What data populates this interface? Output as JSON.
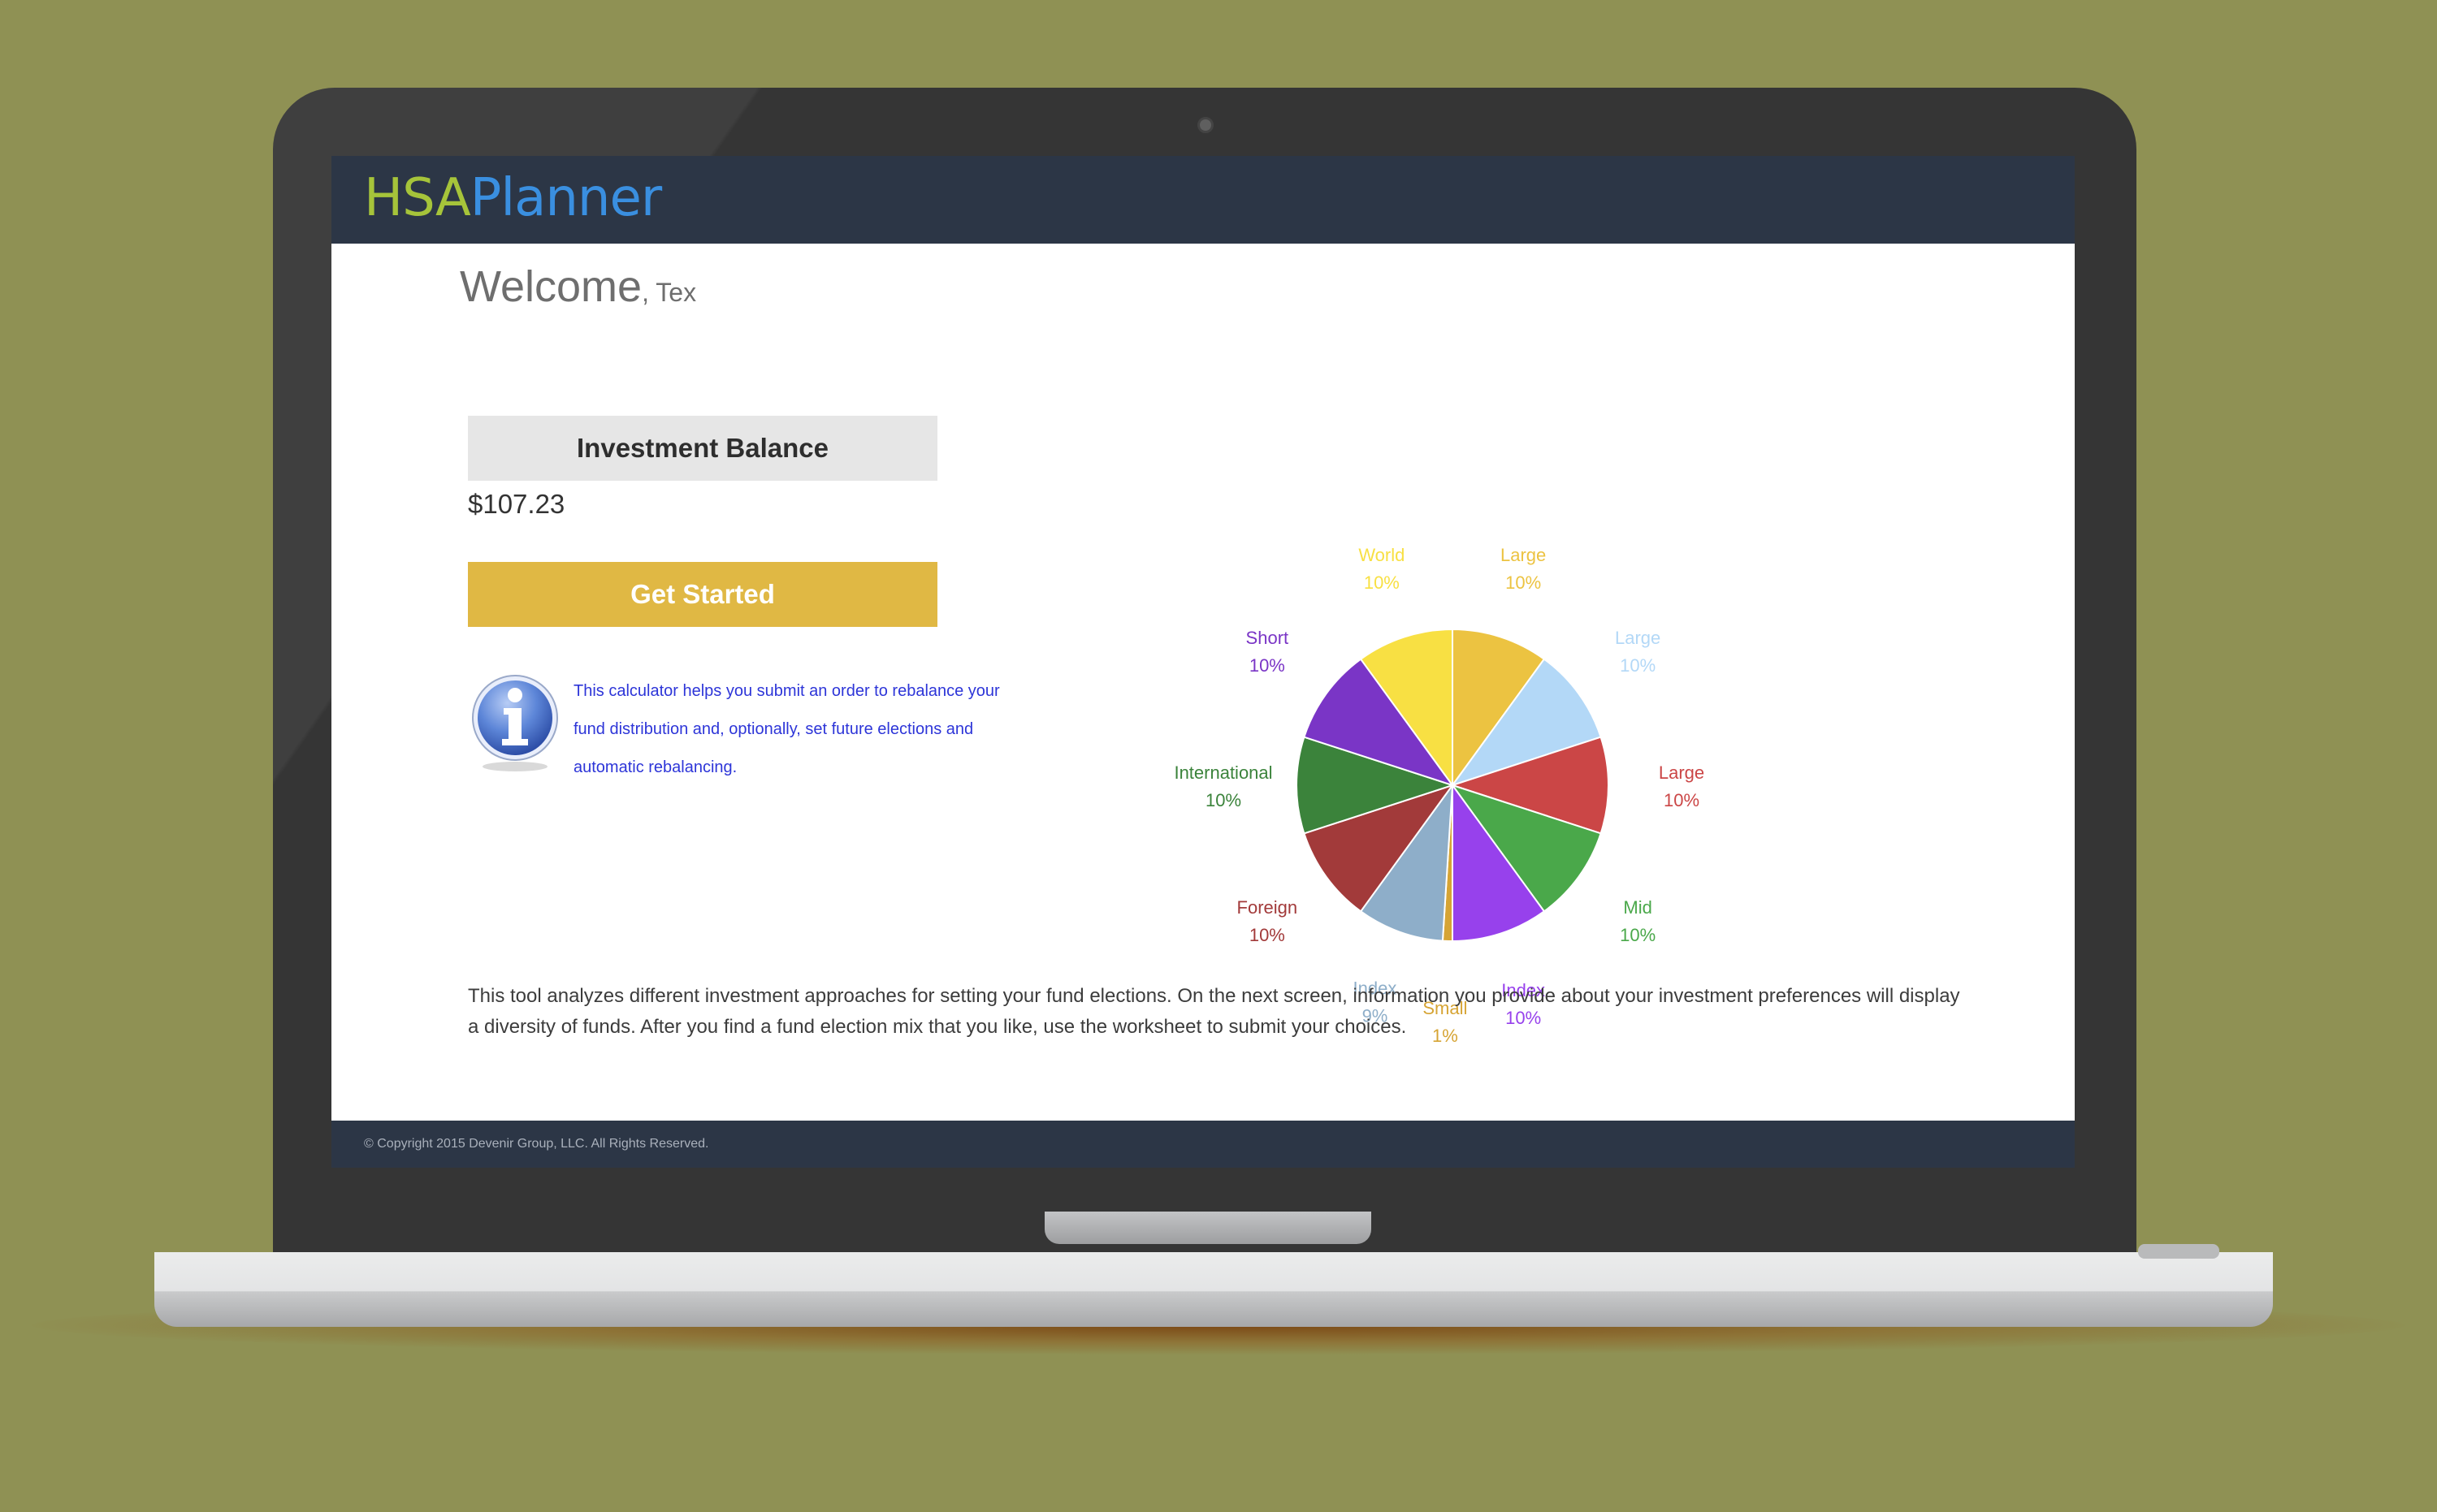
{
  "app": {
    "logo_part1": "HSA",
    "logo_part2": "Planner"
  },
  "welcome": {
    "greeting": "Welcome",
    "name": ", Tex"
  },
  "balance": {
    "label": "Investment Balance",
    "value": "$107.23"
  },
  "actions": {
    "get_started_label": "Get Started"
  },
  "info": {
    "icon": "info-icon",
    "text": "This calculator helps you submit an order to rebalance your fund distribution and, optionally, set future elections and automatic rebalancing."
  },
  "description": "This tool analyzes different investment approaches for setting your fund elections. On the next screen, information you provide about your investment preferences will display a diversity of funds. After you find a fund election mix that you like, use the worksheet to submit your choices.",
  "footer": {
    "copyright": "© Copyright 2015 Devenir Group, LLC. All Rights Reserved."
  },
  "colors": {
    "header_bg": "#2c3646",
    "logo_hsa": "#a6c43a",
    "logo_planner": "#3a8fe0",
    "button_bg": "#e0b844",
    "info_text": "#2d35d8"
  },
  "chart_data": {
    "type": "pie",
    "title": "",
    "legend": "none",
    "slices": [
      {
        "label": "Large",
        "value": 10,
        "display": "10%",
        "color": "#ecc341"
      },
      {
        "label": "Large",
        "value": 10,
        "display": "10%",
        "color": "#b3d8f7"
      },
      {
        "label": "Large",
        "value": 10,
        "display": "10%",
        "color": "#cb4646"
      },
      {
        "label": "Mid",
        "value": 10,
        "display": "10%",
        "color": "#4aa84a"
      },
      {
        "label": "Index",
        "value": 10,
        "display": "10%",
        "color": "#9741ec"
      },
      {
        "label": "Small",
        "value": 1,
        "display": "1%",
        "color": "#d6a434"
      },
      {
        "label": "Index",
        "value": 9,
        "display": "9%",
        "color": "#8eaec9"
      },
      {
        "label": "Foreign",
        "value": 10,
        "display": "10%",
        "color": "#a23a3a"
      },
      {
        "label": "International",
        "value": 10,
        "display": "10%",
        "color": "#3b833b"
      },
      {
        "label": "Short",
        "value": 10,
        "display": "10%",
        "color": "#7a35c6"
      },
      {
        "label": "World",
        "value": 10,
        "display": "10%",
        "color": "#f8e043"
      }
    ]
  }
}
